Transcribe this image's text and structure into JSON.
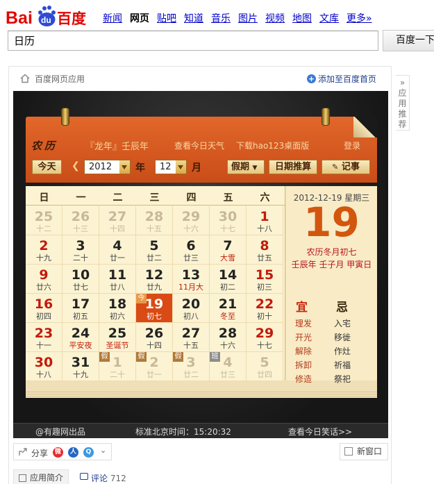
{
  "logo": {
    "text_left": "Bai",
    "text_paw": "du",
    "text_right": "百度"
  },
  "nav": [
    "新闻",
    "网页",
    "贴吧",
    "知道",
    "音乐",
    "图片",
    "视频",
    "地图",
    "文库",
    "更多»"
  ],
  "nav_active": "网页",
  "search": {
    "value": "日历",
    "button": "百度一下"
  },
  "app": {
    "title": "百度网页应用",
    "add_link": "添加至百度首页",
    "side_tab": "应用推荐",
    "calendar": {
      "brand": "农历",
      "year_ganzhi": "『龙年』壬辰年",
      "weather_link": "查看今日天气",
      "download_link": "下载hao123桌面版",
      "login_link": "登录",
      "today_button": "今天",
      "year_value": "2012",
      "year_label": "年",
      "month_value": "12",
      "month_label": "月",
      "holiday_select": "假期",
      "date_calc_button": "日期推算",
      "note_button": "记事",
      "weekdays": [
        "日",
        "一",
        "二",
        "三",
        "四",
        "五",
        "六"
      ],
      "weeks": [
        [
          {
            "d": "25",
            "l": "十二",
            "g": true
          },
          {
            "d": "26",
            "l": "十三",
            "g": true
          },
          {
            "d": "27",
            "l": "十四",
            "g": true
          },
          {
            "d": "28",
            "l": "十五",
            "g": true
          },
          {
            "d": "29",
            "l": "十六",
            "g": true
          },
          {
            "d": "30",
            "l": "十七",
            "g": true
          },
          {
            "d": "1",
            "l": "十八",
            "r": true
          }
        ],
        [
          {
            "d": "2",
            "l": "十九",
            "r": true
          },
          {
            "d": "3",
            "l": "二十"
          },
          {
            "d": "4",
            "l": "廿一"
          },
          {
            "d": "5",
            "l": "廿二"
          },
          {
            "d": "6",
            "l": "廿三"
          },
          {
            "d": "7",
            "l": "大雪",
            "t": true
          },
          {
            "d": "8",
            "l": "廿五",
            "r": true
          }
        ],
        [
          {
            "d": "9",
            "l": "廿六",
            "r": true
          },
          {
            "d": "10",
            "l": "廿七"
          },
          {
            "d": "11",
            "l": "廿八"
          },
          {
            "d": "12",
            "l": "廿九"
          },
          {
            "d": "13",
            "l": "11月大",
            "t": true
          },
          {
            "d": "14",
            "l": "初二"
          },
          {
            "d": "15",
            "l": "初三",
            "r": true
          }
        ],
        [
          {
            "d": "16",
            "l": "初四",
            "r": true
          },
          {
            "d": "17",
            "l": "初五"
          },
          {
            "d": "18",
            "l": "初六"
          },
          {
            "d": "19",
            "l": "初七",
            "today": true,
            "badge": "今"
          },
          {
            "d": "20",
            "l": "初八"
          },
          {
            "d": "21",
            "l": "冬至",
            "t": true
          },
          {
            "d": "22",
            "l": "初十",
            "r": true
          }
        ],
        [
          {
            "d": "23",
            "l": "十一",
            "r": true
          },
          {
            "d": "24",
            "l": "平安夜",
            "t": true
          },
          {
            "d": "25",
            "l": "圣诞节",
            "t": true
          },
          {
            "d": "26",
            "l": "十四"
          },
          {
            "d": "27",
            "l": "十五"
          },
          {
            "d": "28",
            "l": "十六"
          },
          {
            "d": "29",
            "l": "十七",
            "r": true
          }
        ],
        [
          {
            "d": "30",
            "l": "十八",
            "r": true
          },
          {
            "d": "31",
            "l": "十九"
          },
          {
            "d": "1",
            "l": "二十",
            "g": true,
            "badge": "假"
          },
          {
            "d": "2",
            "l": "廿一",
            "g": true,
            "badge": "假"
          },
          {
            "d": "3",
            "l": "廿二",
            "g": true,
            "badge": "假"
          },
          {
            "d": "4",
            "l": "廿三",
            "g": true,
            "badge": "班"
          },
          {
            "d": "5",
            "l": "廿四",
            "g": true
          }
        ]
      ],
      "panel": {
        "date": "2012-12-19 星期三",
        "day": "19",
        "lunar": "农历冬月初七",
        "ganzhi": "壬辰年 壬子月 甲寅日",
        "yi_label": "宜",
        "ji_label": "忌",
        "yi": [
          "理发",
          "开光",
          "解除",
          "拆卸",
          "修造"
        ],
        "ji": [
          "入宅",
          "移徙",
          "作灶",
          "祈福",
          "祭祀"
        ]
      }
    },
    "footer": {
      "credit": "@有趣网出品",
      "time": "标准北京时间：15:20:32",
      "joke_link": "查看今日笑话>>"
    },
    "share_label": "分享",
    "new_window": "新窗口",
    "intro_tab": "应用简介",
    "comment_tab": "评论",
    "comment_count": "712"
  }
}
